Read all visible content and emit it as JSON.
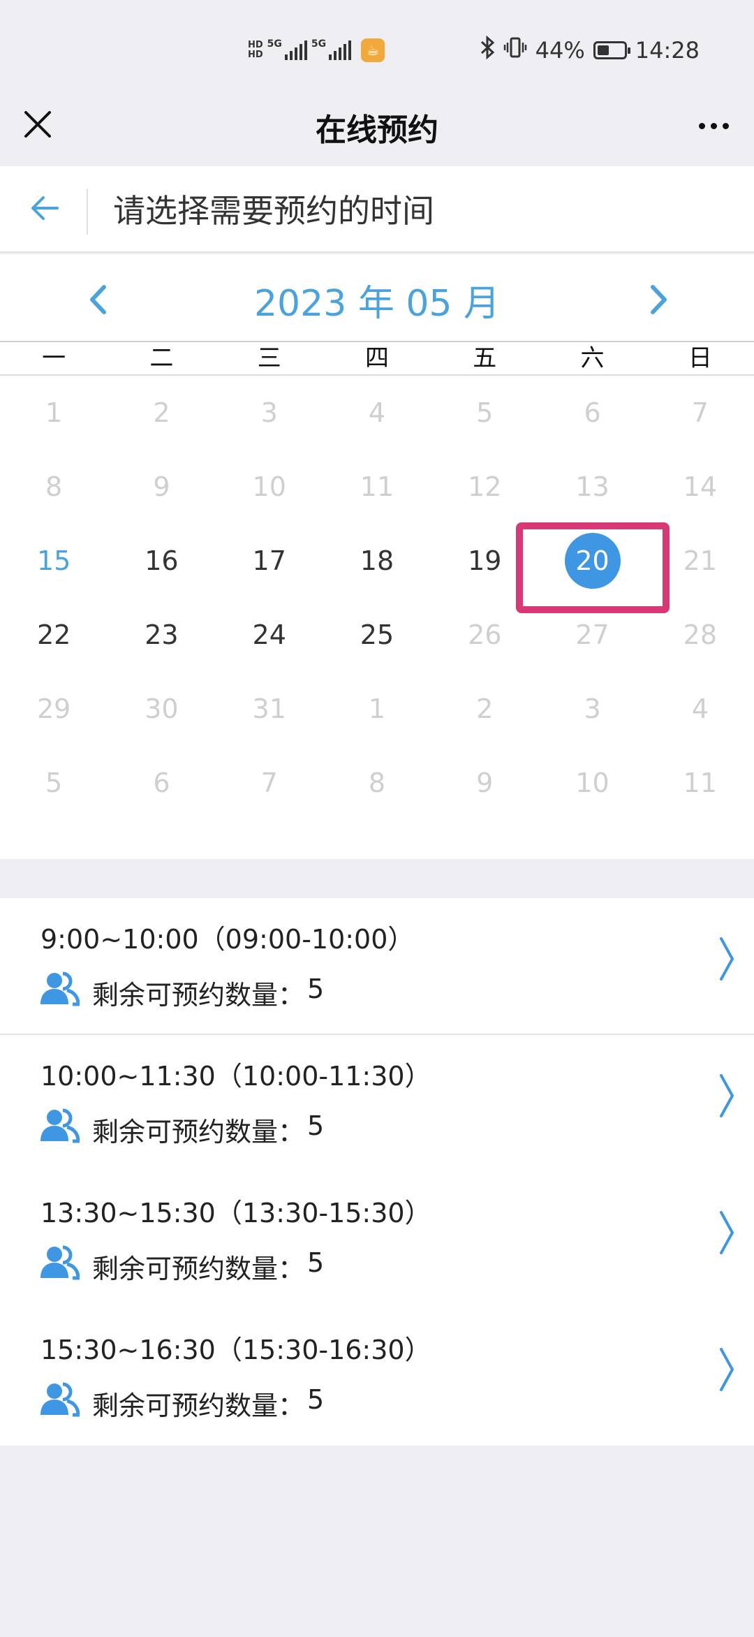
{
  "status_bar": {
    "hd1": "HD",
    "hd2": "HD",
    "net1": "5G",
    "net2": "5G",
    "battery_percent": "44%",
    "battery_level": 0.44,
    "time": "14:28"
  },
  "nav": {
    "title": "在线预约"
  },
  "sub_header": {
    "title": "请选择需要预约的时间"
  },
  "calendar": {
    "year": "2023",
    "month_label": "2023  年 05 月",
    "weekdays": [
      "一",
      "二",
      "三",
      "四",
      "五",
      "六",
      "日"
    ],
    "weeks": [
      [
        {
          "d": "1",
          "s": "muted"
        },
        {
          "d": "2",
          "s": "muted"
        },
        {
          "d": "3",
          "s": "muted"
        },
        {
          "d": "4",
          "s": "muted"
        },
        {
          "d": "5",
          "s": "muted"
        },
        {
          "d": "6",
          "s": "muted"
        },
        {
          "d": "7",
          "s": "muted"
        }
      ],
      [
        {
          "d": "8",
          "s": "muted"
        },
        {
          "d": "9",
          "s": "muted"
        },
        {
          "d": "10",
          "s": "muted"
        },
        {
          "d": "11",
          "s": "muted"
        },
        {
          "d": "12",
          "s": "muted"
        },
        {
          "d": "13",
          "s": "muted"
        },
        {
          "d": "14",
          "s": "muted"
        }
      ],
      [
        {
          "d": "15",
          "s": "today"
        },
        {
          "d": "16",
          "s": "active"
        },
        {
          "d": "17",
          "s": "active"
        },
        {
          "d": "18",
          "s": "active"
        },
        {
          "d": "19",
          "s": "active"
        },
        {
          "d": "20",
          "s": "selected"
        },
        {
          "d": "21",
          "s": "muted"
        }
      ],
      [
        {
          "d": "22",
          "s": "active"
        },
        {
          "d": "23",
          "s": "active"
        },
        {
          "d": "24",
          "s": "active"
        },
        {
          "d": "25",
          "s": "active"
        },
        {
          "d": "26",
          "s": "muted"
        },
        {
          "d": "27",
          "s": "muted"
        },
        {
          "d": "28",
          "s": "muted"
        }
      ],
      [
        {
          "d": "29",
          "s": "muted"
        },
        {
          "d": "30",
          "s": "muted"
        },
        {
          "d": "31",
          "s": "muted"
        },
        {
          "d": "1",
          "s": "muted"
        },
        {
          "d": "2",
          "s": "muted"
        },
        {
          "d": "3",
          "s": "muted"
        },
        {
          "d": "4",
          "s": "muted"
        }
      ],
      [
        {
          "d": "5",
          "s": "muted"
        },
        {
          "d": "6",
          "s": "muted"
        },
        {
          "d": "7",
          "s": "muted"
        },
        {
          "d": "8",
          "s": "muted"
        },
        {
          "d": "9",
          "s": "muted"
        },
        {
          "d": "10",
          "s": "muted"
        },
        {
          "d": "11",
          "s": "muted"
        }
      ]
    ],
    "selected_day": "20"
  },
  "slots": {
    "remain_label": "剩余可预约数量：",
    "items": [
      {
        "time": "9:00~10:00（09:00-10:00）",
        "remaining": "5"
      },
      {
        "time": "10:00~11:30（10:00-11:30）",
        "remaining": "5"
      },
      {
        "time": "13:30~15:30（13:30-15:30）",
        "remaining": "5"
      },
      {
        "time": "15:30~16:30（15:30-16:30）",
        "remaining": "5"
      }
    ]
  },
  "colors": {
    "accent": "#4aa3dd",
    "selected": "#3f96e3",
    "highlight": "#d83874",
    "muted": "#cfcfcf"
  }
}
